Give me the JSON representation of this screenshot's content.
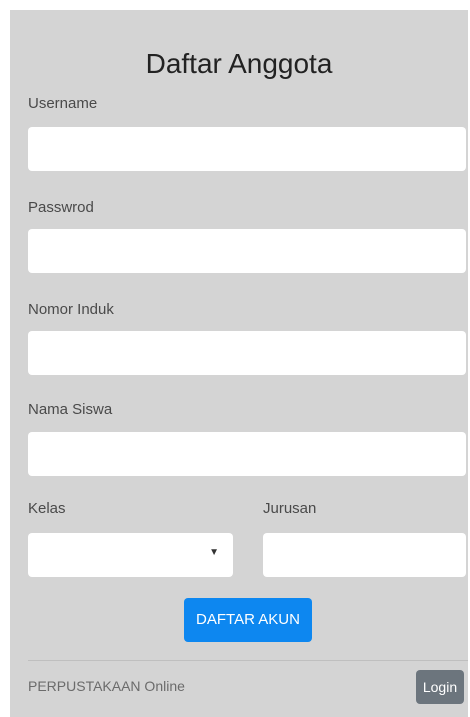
{
  "form": {
    "title": "Daftar Anggota",
    "username": {
      "label": "Username",
      "value": ""
    },
    "password": {
      "label": "Passwrod",
      "value": ""
    },
    "nomor_induk": {
      "label": "Nomor Induk",
      "value": ""
    },
    "nama_siswa": {
      "label": "Nama Siswa",
      "value": ""
    },
    "kelas": {
      "label": "Kelas",
      "selected": ""
    },
    "jurusan": {
      "label": "Jurusan",
      "value": ""
    },
    "submit_label": "DAFTAR AKUN"
  },
  "footer": {
    "brand": "PERPUSTAKAAN Online",
    "login_label": "Login"
  },
  "colors": {
    "card_background": "#d4d4d4",
    "primary_button": "#0d87f0",
    "secondary_button": "#6c757d"
  }
}
